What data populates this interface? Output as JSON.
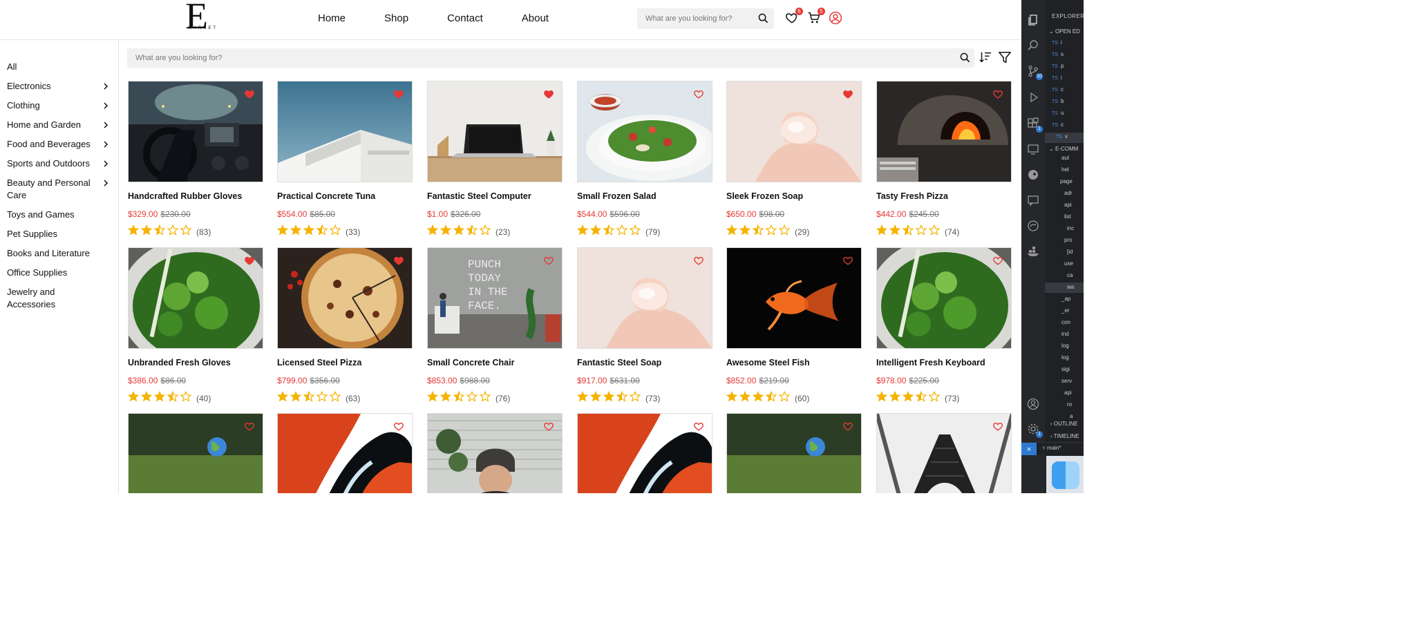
{
  "header": {
    "logo_letter": "E",
    "logo_word": "MARKET",
    "nav": [
      "Home",
      "Shop",
      "Contact",
      "About"
    ],
    "search_placeholder": "What are you looking for?",
    "wishlist_count": "6",
    "cart_count": "5"
  },
  "sidebar": {
    "categories": [
      {
        "label": "All",
        "has_children": false
      },
      {
        "label": "Electronics",
        "has_children": true
      },
      {
        "label": "Clothing",
        "has_children": true
      },
      {
        "label": "Home and Garden",
        "has_children": true
      },
      {
        "label": "Food and Beverages",
        "has_children": true
      },
      {
        "label": "Sports and Outdoors",
        "has_children": true
      },
      {
        "label": "Beauty and Personal Care",
        "has_children": true
      },
      {
        "label": "Toys and Games",
        "has_children": false
      },
      {
        "label": "Pet Supplies",
        "has_children": false
      },
      {
        "label": "Books and Literature",
        "has_children": false
      },
      {
        "label": "Office Supplies",
        "has_children": false
      },
      {
        "label": "Jewelry and Accessories",
        "has_children": false
      }
    ]
  },
  "content": {
    "search_placeholder": "What are you looking for?"
  },
  "products": [
    {
      "name": "Handcrafted Rubber Gloves",
      "price": "$329.00",
      "old_price": "$230.00",
      "rating": 2.5,
      "reviews": "(83)",
      "favorited": true,
      "image": "car-dashboard"
    },
    {
      "name": "Practical Concrete Tuna",
      "price": "$554.00",
      "old_price": "$85.00",
      "rating": 3.5,
      "reviews": "(33)",
      "favorited": true,
      "image": "white-building"
    },
    {
      "name": "Fantastic Steel Computer",
      "price": "$1.00",
      "old_price": "$326.00",
      "rating": 3.5,
      "reviews": "(23)",
      "favorited": true,
      "image": "laptop-desk"
    },
    {
      "name": "Small Frozen Salad",
      "price": "$544.00",
      "old_price": "$596.00",
      "rating": 2.5,
      "reviews": "(79)",
      "favorited": false,
      "image": "salad-plate"
    },
    {
      "name": "Sleek Frozen Soap",
      "price": "$650.00",
      "old_price": "$98.00",
      "rating": 2.5,
      "reviews": "(29)",
      "favorited": true,
      "image": "hand-soap"
    },
    {
      "name": "Tasty Fresh Pizza",
      "price": "$442.00",
      "old_price": "$245.00",
      "rating": 2.5,
      "reviews": "(74)",
      "favorited": false,
      "image": "pizza-oven"
    },
    {
      "name": "Unbranded Fresh Gloves",
      "price": "$386.00",
      "old_price": "$86.00",
      "rating": 3.5,
      "reviews": "(40)",
      "favorited": true,
      "image": "greens-bowl"
    },
    {
      "name": "Licensed Steel Pizza",
      "price": "$799.00",
      "old_price": "$356.00",
      "rating": 2.5,
      "reviews": "(63)",
      "favorited": true,
      "image": "pizza"
    },
    {
      "name": "Small Concrete Chair",
      "price": "$853.00",
      "old_price": "$988.00",
      "rating": 2.5,
      "reviews": "(76)",
      "favorited": false,
      "image": "punch-wall"
    },
    {
      "name": "Fantastic Steel Soap",
      "price": "$917.00",
      "old_price": "$631.00",
      "rating": 3.5,
      "reviews": "(73)",
      "favorited": false,
      "image": "hand-soap"
    },
    {
      "name": "Awesome Steel Fish",
      "price": "$852.00",
      "old_price": "$219.00",
      "rating": 3.5,
      "reviews": "(60)",
      "favorited": false,
      "image": "goldfish"
    },
    {
      "name": "Intelligent Fresh Keyboard",
      "price": "$978.00",
      "old_price": "$225.00",
      "rating": 3.5,
      "reviews": "(73)",
      "favorited": false,
      "image": "greens-bowl"
    },
    {
      "name": "",
      "price": "",
      "old_price": "",
      "rating": 0,
      "reviews": "",
      "favorited": false,
      "image": "globe-grass"
    },
    {
      "name": "",
      "price": "",
      "old_price": "",
      "rating": 0,
      "reviews": "",
      "favorited": false,
      "image": "orange-car"
    },
    {
      "name": "",
      "price": "",
      "old_price": "",
      "rating": 0,
      "reviews": "",
      "favorited": false,
      "image": "man-beanie"
    },
    {
      "name": "",
      "price": "",
      "old_price": "",
      "rating": 0,
      "reviews": "",
      "favorited": false,
      "image": "orange-car"
    },
    {
      "name": "",
      "price": "",
      "old_price": "",
      "rating": 0,
      "reviews": "",
      "favorited": false,
      "image": "globe-grass"
    },
    {
      "name": "",
      "price": "",
      "old_price": "",
      "rating": 0,
      "reviews": "",
      "favorited": false,
      "image": "eiffel-tower"
    }
  ],
  "editor": {
    "explorer_title": "EXPLORER",
    "open_editors": "OPEN ED",
    "project": "E-COMM",
    "files": [
      "i",
      "s",
      "p",
      "i",
      "c",
      "b",
      "u",
      "c",
      "v"
    ],
    "tree": [
      "aut",
      "hel",
      "page",
      "adr",
      "api",
      "list",
      "inc",
      "pro",
      "[id",
      "use",
      "ca",
      "wa",
      "_ap",
      "_er",
      "con",
      "ind",
      "log",
      "log",
      "sigi",
      "serv",
      "api",
      "ro",
      "a"
    ],
    "source_control_badge": "10",
    "extensions_badge": "1",
    "settings_badge": "1",
    "outline": "OUTLINE",
    "timeline": "TIMELINE",
    "branch": "main*",
    "colors": {
      "accent": "#2e7ad1",
      "sale": "#e53935",
      "star": "#f5b301"
    }
  }
}
